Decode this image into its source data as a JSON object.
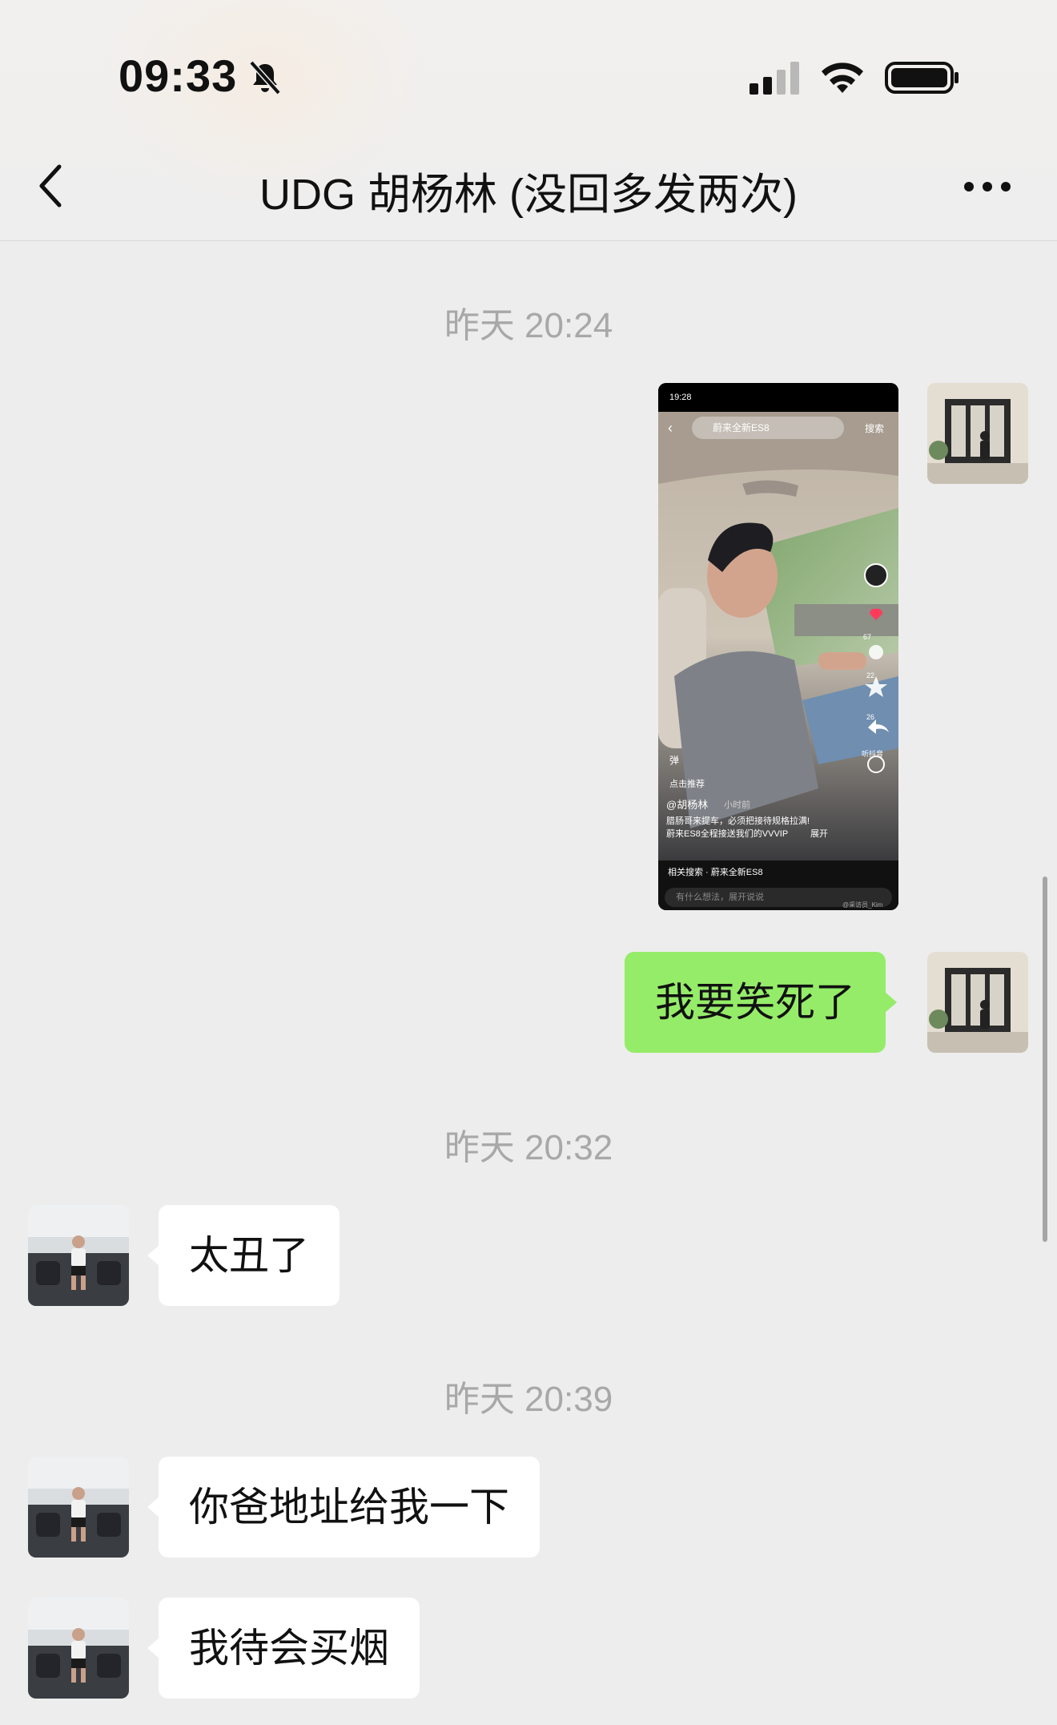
{
  "status_bar": {
    "time": "09:33"
  },
  "header": {
    "title": "UDG 胡杨林 (没回多发两次)"
  },
  "messages": [
    {
      "type": "timestamp",
      "text": "昨天 20:24"
    },
    {
      "type": "video_share",
      "side": "right",
      "video": {
        "status_time": "19:28",
        "search_text": "蔚来全新ES8",
        "search_button": "搜索",
        "danmu": "弹",
        "recommend": "点击推荐",
        "author": "@胡杨林",
        "time_ago": "小时前",
        "caption_line1": "腊肠哥来提车，必须把接待规格拉满!",
        "caption_line2": "蔚来ES8全程接送我们的VVVIP",
        "expand": "展开",
        "like_count": "",
        "comment_count": "67",
        "fav_count": "22",
        "share_count": "26",
        "listen": "听抖音",
        "related_search": "相关搜索 · 蔚来全新ES8",
        "input_placeholder": "有什么想法，展开说说",
        "watermark": "@采访员_Kim"
      }
    },
    {
      "type": "text",
      "side": "right",
      "text": "我要笑死了"
    },
    {
      "type": "timestamp",
      "text": "昨天 20:32"
    },
    {
      "type": "text",
      "side": "left",
      "text": "太丑了"
    },
    {
      "type": "timestamp",
      "text": "昨天 20:39"
    },
    {
      "type": "text",
      "side": "left",
      "text": "你爸地址给我一下"
    },
    {
      "type": "text",
      "side": "left",
      "text": "我待会买烟"
    }
  ],
  "colors": {
    "my_bubble": "#95ec69",
    "their_bubble": "#ffffff",
    "background": "#ededed"
  }
}
